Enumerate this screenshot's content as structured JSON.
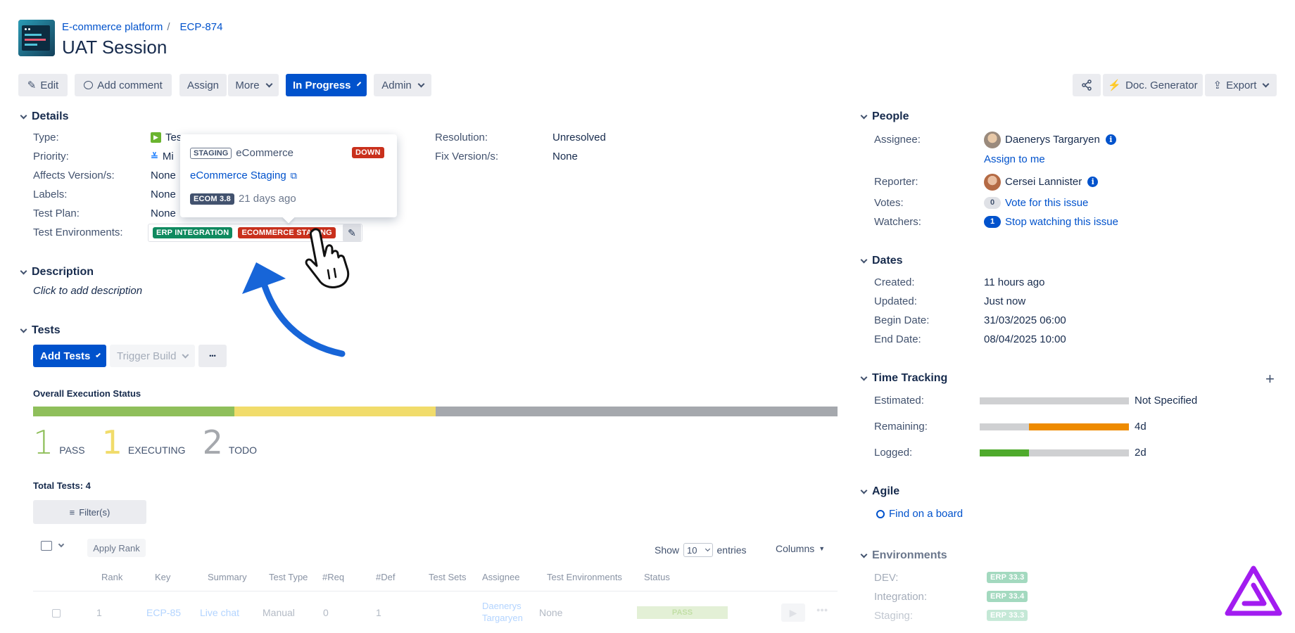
{
  "breadcrumb": {
    "project": "E-commerce platform",
    "separator": "/",
    "issue_key": "ECP-874"
  },
  "page_title": "UAT Session",
  "toolbar": {
    "edit": "Edit",
    "add_comment": "Add comment",
    "assign": "Assign",
    "more": "More",
    "status": "In Progress",
    "admin": "Admin",
    "doc_generator": "Doc. Generator",
    "export": "Export"
  },
  "details": {
    "title": "Details",
    "type_label": "Type:",
    "type_value": "Tes",
    "priority_label": "Priority:",
    "priority_value": "Mi",
    "affects_label": "Affects Version/s:",
    "affects_value": "None",
    "labels_label": "Labels:",
    "labels_value": "None",
    "testplan_label": "Test Plan:",
    "testplan_value": "None",
    "testenv_label": "Test Environments:",
    "env_tags": [
      "ERP INTEGRATION",
      "ECOMMERCE STAGING"
    ],
    "resolution_label": "Resolution:",
    "resolution_value": "Unresolved",
    "fixversion_label": "Fix Version/s:",
    "fixversion_value": "None"
  },
  "popup": {
    "badge": "STAGING",
    "name": "eCommerce",
    "status": "DOWN",
    "link": "eCommerce Staging",
    "version_badge": "ECOM 3.8",
    "time": "21 days ago"
  },
  "description": {
    "title": "Description",
    "placeholder": "Click to add description"
  },
  "tests": {
    "title": "Tests",
    "add_tests": "Add Tests",
    "trigger_build": "Trigger Build",
    "more": "•••",
    "overall_status": "Overall Execution Status",
    "progress": {
      "pass": 0.25,
      "executing": 0.25,
      "todo": 0.5
    },
    "pass_count": "1",
    "pass_label": "PASS",
    "executing_count": "1",
    "executing_label": "EXECUTING",
    "todo_count": "2",
    "todo_label": "TODO",
    "total": "Total Tests: 4",
    "filter": "Filter(s)",
    "apply_rank": "Apply Rank",
    "show": "Show",
    "entries_value": "10",
    "entries": "entries",
    "columns": "Columns",
    "headers": [
      "Rank",
      "Key",
      "Summary",
      "Test Type",
      "#Req",
      "#Def",
      "Test Sets",
      "Assignee",
      "Test Environments",
      "Status"
    ],
    "row": {
      "rank": "1",
      "key": "ECP-85",
      "summary": "Live chat",
      "type": "Manual",
      "req": "0",
      "def": "1",
      "assignee_first": "Daenerys",
      "assignee_last": "Targaryen",
      "env": "None",
      "status": "PASS"
    }
  },
  "people": {
    "title": "People",
    "assignee_label": "Assignee:",
    "assignee": "Daenerys Targaryen",
    "assign_to_me": "Assign to me",
    "reporter_label": "Reporter:",
    "reporter": "Cersei Lannister",
    "votes_label": "Votes:",
    "votes_count": "0",
    "vote_link": "Vote for this issue",
    "watchers_label": "Watchers:",
    "watchers_count": "1",
    "watch_link": "Stop watching this issue"
  },
  "dates": {
    "title": "Dates",
    "created_label": "Created:",
    "created": "11 hours ago",
    "updated_label": "Updated:",
    "updated": "Just now",
    "begin_label": "Begin Date:",
    "begin": "31/03/2025 06:00",
    "end_label": "End Date:",
    "end": "08/04/2025 10:00"
  },
  "time_tracking": {
    "title": "Time Tracking",
    "add": "+",
    "estimated_label": "Estimated:",
    "estimated": "Not Specified",
    "remaining_label": "Remaining:",
    "remaining": "4d",
    "remaining_fill": 0.67,
    "logged_label": "Logged:",
    "logged": "2d",
    "logged_fill": 0.33
  },
  "agile": {
    "title": "Agile",
    "find_board": "Find on a board"
  },
  "environments": {
    "title": "Environments",
    "dev_label": "DEV:",
    "dev": "ERP 33.3",
    "integration_label": "Integration:",
    "integration": "ERP 33.4",
    "staging_label": "Staging:",
    "staging": "ERP 33.3"
  },
  "colors": {
    "primary": "#0052cc",
    "pass": "#8fbf5b",
    "executing": "#f1dc6b",
    "todo": "#a5a8ad",
    "erp_tag": "#0f8a5f",
    "ecom_tag": "#c9301c",
    "brand_logo": "#a21cf0",
    "cursor_arrow": "#1765d8"
  }
}
